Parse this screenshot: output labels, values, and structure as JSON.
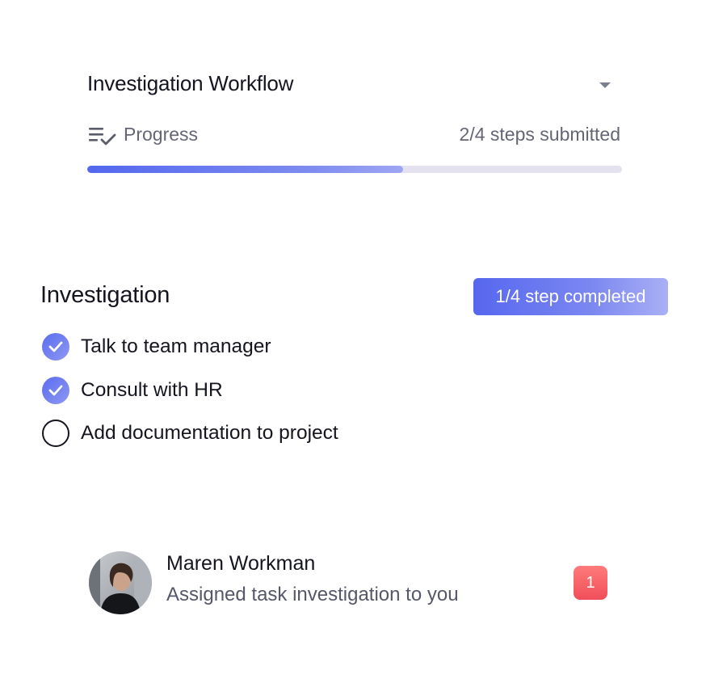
{
  "workflow": {
    "title": "Investigation Workflow",
    "dropdown_icon": "caret-down-icon",
    "progress_icon": "checklist-icon",
    "progress_label": "Progress",
    "steps_submitted": "2/4 steps submitted",
    "progress_fraction": 0.59
  },
  "investigation": {
    "title": "Investigation",
    "badge": "1/4 step completed",
    "tasks": [
      {
        "label": "Talk to team manager",
        "done": true
      },
      {
        "label": "Consult with HR",
        "done": true
      },
      {
        "label": "Add documentation to project",
        "done": false
      }
    ]
  },
  "notification": {
    "name": "Maren Workman",
    "message": "Assigned task investigation to you",
    "count": "1"
  },
  "colors": {
    "accent": "#5367ee",
    "accent_light": "#9ea6f3",
    "track": "#e3e2ee",
    "badge_red": "#f04e5a"
  }
}
